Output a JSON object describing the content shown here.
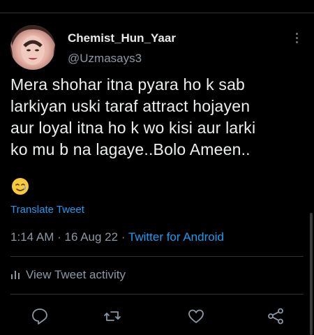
{
  "tweet": {
    "display_name": "Chemist_Hun_Yaar",
    "handle": "@Uzmasays3",
    "text_lines": [
      "Mera shohar itna pyara ho k sab",
      "larkiyan uski taraf attract hojayen",
      "aur loyal itna ho k wo kisi aur larki",
      "ko mu b na lagaye..Bolo Ameen.."
    ],
    "emoji": "smiling-face-with-tear",
    "translate_label": "Translate Tweet",
    "time": "1:14 AM",
    "date": "16 Aug 22",
    "separator": "·",
    "source": "Twitter for Android",
    "activity_label": "View Tweet activity"
  },
  "actions": [
    "reply-icon",
    "retweet-icon",
    "like-icon",
    "share-icon"
  ],
  "colors": {
    "background": "#000000",
    "text": "#e7e9ea",
    "secondary": "#8b98a5",
    "accent": "#1d9bf0",
    "divider": "#2f3336"
  }
}
